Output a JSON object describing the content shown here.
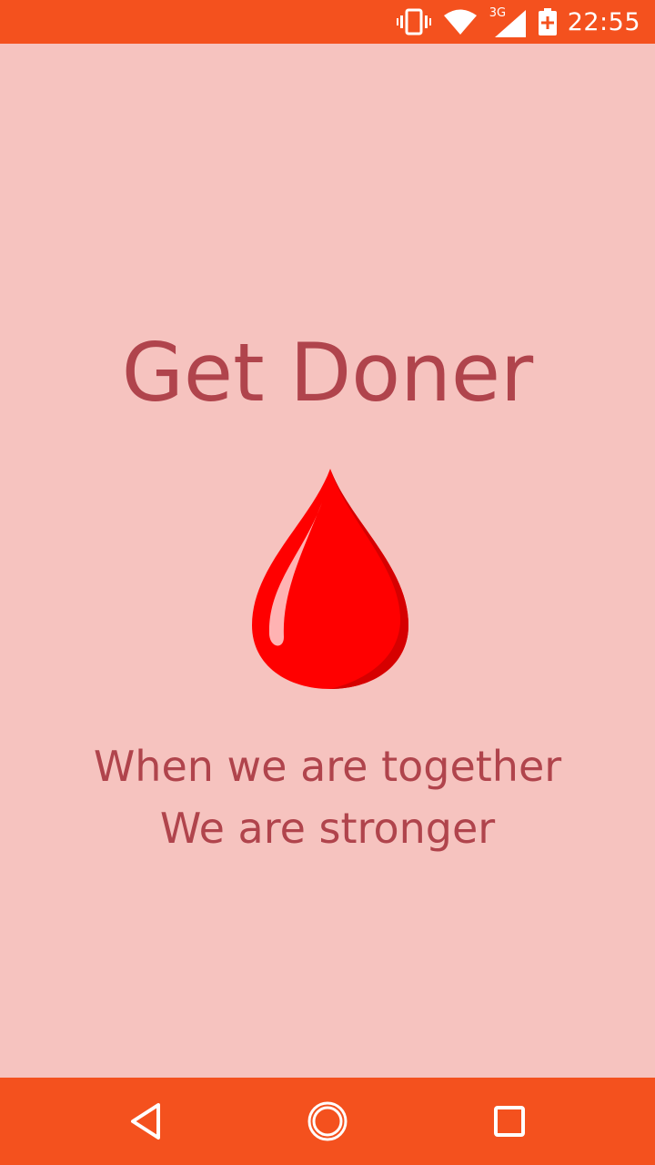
{
  "status_bar": {
    "time": "22:55",
    "network_type": "3G",
    "icons": [
      "vibrate-icon",
      "wifi-icon",
      "signal-icon",
      "battery-charging-icon"
    ]
  },
  "main": {
    "title": "Get Doner",
    "logo": "blood-drop-icon",
    "tagline_line1": "When we are together",
    "tagline_line2": "We are stronger"
  },
  "nav_bar": {
    "buttons": [
      "back-icon",
      "home-icon",
      "recents-icon"
    ]
  },
  "colors": {
    "accent": "#f4511e",
    "background": "#f6c3bf",
    "text": "#b0444c",
    "drop": "#ff0000"
  }
}
